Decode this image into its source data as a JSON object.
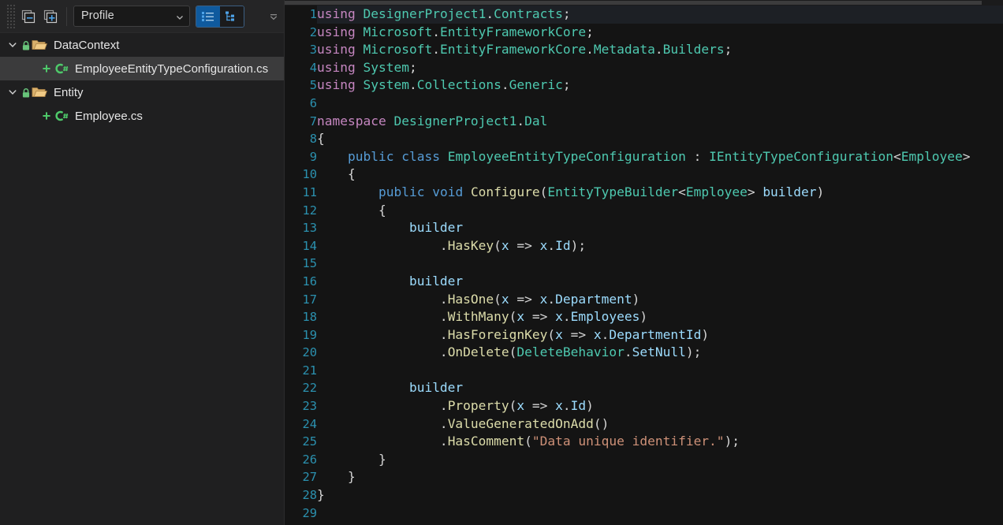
{
  "toolbar": {
    "collapse_all_label": "Collapse All",
    "expand_all_label": "Expand All",
    "profile_value": "Profile",
    "profile_placeholder": "Profile",
    "view_list_label": "List View",
    "view_tree_label": "Tree View",
    "overflow_label": "More",
    "icons": {
      "collapse": "collapse-all-icon",
      "expand": "expand-all-icon",
      "chevron": "chevron-down-icon",
      "list": "list-view-icon",
      "tree": "tree-view-icon",
      "overflow": "overflow-chevron-icon"
    }
  },
  "tree": {
    "nodes": [
      {
        "label": "DataContext",
        "type": "folder",
        "level": 0,
        "expanded": true,
        "locked": true,
        "selected": false
      },
      {
        "label": "EmployeeEntityTypeConfiguration.cs",
        "type": "csharp",
        "level": 1,
        "expanded": false,
        "locked": false,
        "selected": true
      },
      {
        "label": "Entity",
        "type": "folder",
        "level": 0,
        "expanded": true,
        "locked": true,
        "selected": false
      },
      {
        "label": "Employee.cs",
        "type": "csharp",
        "level": 1,
        "expanded": false,
        "locked": false,
        "selected": false
      }
    ]
  },
  "colors": {
    "accent": "#0f5a9e",
    "keyword": "#c586c0",
    "control_keyword": "#569cd6",
    "type": "#4ec9b0",
    "identifier": "#9cdcfe",
    "method": "#dcdcaa",
    "string": "#ce9178",
    "line_number": "#2b91af",
    "selection": "#3b3b3c",
    "editor_bg": "#141414",
    "panel_bg": "#1f1f20",
    "csharp_icon": "#4ec96a",
    "folder_icon": "#dcb67a",
    "lock_icon": "#68c47a"
  },
  "editor": {
    "first_line": 1,
    "last_line": 29,
    "current_line": 1,
    "lines": [
      {
        "n": 1,
        "tokens": [
          {
            "t": "using",
            "c": "k"
          },
          {
            "t": " ",
            "c": "p"
          },
          {
            "t": "DesignerProject1",
            "c": "ty"
          },
          {
            "t": ".",
            "c": "p"
          },
          {
            "t": "Contracts",
            "c": "ty"
          },
          {
            "t": ";",
            "c": "p"
          }
        ]
      },
      {
        "n": 2,
        "tokens": [
          {
            "t": "using",
            "c": "k"
          },
          {
            "t": " ",
            "c": "p"
          },
          {
            "t": "Microsoft",
            "c": "ty"
          },
          {
            "t": ".",
            "c": "p"
          },
          {
            "t": "EntityFrameworkCore",
            "c": "ty"
          },
          {
            "t": ";",
            "c": "p"
          }
        ]
      },
      {
        "n": 3,
        "tokens": [
          {
            "t": "using",
            "c": "k"
          },
          {
            "t": " ",
            "c": "p"
          },
          {
            "t": "Microsoft",
            "c": "ty"
          },
          {
            "t": ".",
            "c": "p"
          },
          {
            "t": "EntityFrameworkCore",
            "c": "ty"
          },
          {
            "t": ".",
            "c": "p"
          },
          {
            "t": "Metadata",
            "c": "ty"
          },
          {
            "t": ".",
            "c": "p"
          },
          {
            "t": "Builders",
            "c": "ty"
          },
          {
            "t": ";",
            "c": "p"
          }
        ]
      },
      {
        "n": 4,
        "tokens": [
          {
            "t": "using",
            "c": "k"
          },
          {
            "t": " ",
            "c": "p"
          },
          {
            "t": "System",
            "c": "ty"
          },
          {
            "t": ";",
            "c": "p"
          }
        ]
      },
      {
        "n": 5,
        "tokens": [
          {
            "t": "using",
            "c": "k"
          },
          {
            "t": " ",
            "c": "p"
          },
          {
            "t": "System",
            "c": "ty"
          },
          {
            "t": ".",
            "c": "p"
          },
          {
            "t": "Collections",
            "c": "ty"
          },
          {
            "t": ".",
            "c": "p"
          },
          {
            "t": "Generic",
            "c": "ty"
          },
          {
            "t": ";",
            "c": "p"
          }
        ]
      },
      {
        "n": 6,
        "tokens": []
      },
      {
        "n": 7,
        "tokens": [
          {
            "t": "namespace",
            "c": "k"
          },
          {
            "t": " ",
            "c": "p"
          },
          {
            "t": "DesignerProject1",
            "c": "ty"
          },
          {
            "t": ".",
            "c": "p"
          },
          {
            "t": "Dal",
            "c": "ty"
          }
        ]
      },
      {
        "n": 8,
        "tokens": [
          {
            "t": "{",
            "c": "p"
          }
        ]
      },
      {
        "n": 9,
        "tokens": [
          {
            "t": "    ",
            "c": "p"
          },
          {
            "t": "public",
            "c": "kb"
          },
          {
            "t": " ",
            "c": "p"
          },
          {
            "t": "class",
            "c": "kb"
          },
          {
            "t": " ",
            "c": "p"
          },
          {
            "t": "EmployeeEntityTypeConfiguration",
            "c": "ty"
          },
          {
            "t": " : ",
            "c": "p"
          },
          {
            "t": "IEntityTypeConfiguration",
            "c": "ty"
          },
          {
            "t": "<",
            "c": "p"
          },
          {
            "t": "Employee",
            "c": "ty"
          },
          {
            "t": ">",
            "c": "p"
          }
        ]
      },
      {
        "n": 10,
        "tokens": [
          {
            "t": "    ",
            "c": "p"
          },
          {
            "t": "{",
            "c": "p"
          }
        ]
      },
      {
        "n": 11,
        "tokens": [
          {
            "t": "        ",
            "c": "p"
          },
          {
            "t": "public",
            "c": "kb"
          },
          {
            "t": " ",
            "c": "p"
          },
          {
            "t": "void",
            "c": "kb"
          },
          {
            "t": " ",
            "c": "p"
          },
          {
            "t": "Configure",
            "c": "fn"
          },
          {
            "t": "(",
            "c": "p"
          },
          {
            "t": "EntityTypeBuilder",
            "c": "ty"
          },
          {
            "t": "<",
            "c": "p"
          },
          {
            "t": "Employee",
            "c": "ty"
          },
          {
            "t": "> ",
            "c": "p"
          },
          {
            "t": "builder",
            "c": "id"
          },
          {
            "t": ")",
            "c": "p"
          }
        ]
      },
      {
        "n": 12,
        "tokens": [
          {
            "t": "        ",
            "c": "p"
          },
          {
            "t": "{",
            "c": "p"
          }
        ]
      },
      {
        "n": 13,
        "tokens": [
          {
            "t": "            ",
            "c": "p"
          },
          {
            "t": "builder",
            "c": "id"
          }
        ]
      },
      {
        "n": 14,
        "tokens": [
          {
            "t": "                .",
            "c": "p"
          },
          {
            "t": "HasKey",
            "c": "fn"
          },
          {
            "t": "(",
            "c": "p"
          },
          {
            "t": "x",
            "c": "id"
          },
          {
            "t": " => ",
            "c": "p"
          },
          {
            "t": "x",
            "c": "id"
          },
          {
            "t": ".",
            "c": "p"
          },
          {
            "t": "Id",
            "c": "id"
          },
          {
            "t": ");",
            "c": "p"
          }
        ]
      },
      {
        "n": 15,
        "tokens": []
      },
      {
        "n": 16,
        "tokens": [
          {
            "t": "            ",
            "c": "p"
          },
          {
            "t": "builder",
            "c": "id"
          }
        ]
      },
      {
        "n": 17,
        "tokens": [
          {
            "t": "                .",
            "c": "p"
          },
          {
            "t": "HasOne",
            "c": "fn"
          },
          {
            "t": "(",
            "c": "p"
          },
          {
            "t": "x",
            "c": "id"
          },
          {
            "t": " => ",
            "c": "p"
          },
          {
            "t": "x",
            "c": "id"
          },
          {
            "t": ".",
            "c": "p"
          },
          {
            "t": "Department",
            "c": "id"
          },
          {
            "t": ")",
            "c": "p"
          }
        ]
      },
      {
        "n": 18,
        "tokens": [
          {
            "t": "                .",
            "c": "p"
          },
          {
            "t": "WithMany",
            "c": "fn"
          },
          {
            "t": "(",
            "c": "p"
          },
          {
            "t": "x",
            "c": "id"
          },
          {
            "t": " => ",
            "c": "p"
          },
          {
            "t": "x",
            "c": "id"
          },
          {
            "t": ".",
            "c": "p"
          },
          {
            "t": "Employees",
            "c": "id"
          },
          {
            "t": ")",
            "c": "p"
          }
        ]
      },
      {
        "n": 19,
        "tokens": [
          {
            "t": "                .",
            "c": "p"
          },
          {
            "t": "HasForeignKey",
            "c": "fn"
          },
          {
            "t": "(",
            "c": "p"
          },
          {
            "t": "x",
            "c": "id"
          },
          {
            "t": " => ",
            "c": "p"
          },
          {
            "t": "x",
            "c": "id"
          },
          {
            "t": ".",
            "c": "p"
          },
          {
            "t": "DepartmentId",
            "c": "id"
          },
          {
            "t": ")",
            "c": "p"
          }
        ]
      },
      {
        "n": 20,
        "tokens": [
          {
            "t": "                .",
            "c": "p"
          },
          {
            "t": "OnDelete",
            "c": "fn"
          },
          {
            "t": "(",
            "c": "p"
          },
          {
            "t": "DeleteBehavior",
            "c": "ty"
          },
          {
            "t": ".",
            "c": "p"
          },
          {
            "t": "SetNull",
            "c": "id"
          },
          {
            "t": ");",
            "c": "p"
          }
        ]
      },
      {
        "n": 21,
        "tokens": []
      },
      {
        "n": 22,
        "tokens": [
          {
            "t": "            ",
            "c": "p"
          },
          {
            "t": "builder",
            "c": "id"
          }
        ]
      },
      {
        "n": 23,
        "tokens": [
          {
            "t": "                .",
            "c": "p"
          },
          {
            "t": "Property",
            "c": "fn"
          },
          {
            "t": "(",
            "c": "p"
          },
          {
            "t": "x",
            "c": "id"
          },
          {
            "t": " => ",
            "c": "p"
          },
          {
            "t": "x",
            "c": "id"
          },
          {
            "t": ".",
            "c": "p"
          },
          {
            "t": "Id",
            "c": "id"
          },
          {
            "t": ")",
            "c": "p"
          }
        ]
      },
      {
        "n": 24,
        "tokens": [
          {
            "t": "                .",
            "c": "p"
          },
          {
            "t": "ValueGeneratedOnAdd",
            "c": "fn"
          },
          {
            "t": "()",
            "c": "p"
          }
        ]
      },
      {
        "n": 25,
        "tokens": [
          {
            "t": "                .",
            "c": "p"
          },
          {
            "t": "HasComment",
            "c": "fn"
          },
          {
            "t": "(",
            "c": "p"
          },
          {
            "t": "\"Data unique identifier.\"",
            "c": "st"
          },
          {
            "t": ");",
            "c": "p"
          }
        ]
      },
      {
        "n": 26,
        "tokens": [
          {
            "t": "        ",
            "c": "p"
          },
          {
            "t": "}",
            "c": "p"
          }
        ]
      },
      {
        "n": 27,
        "tokens": [
          {
            "t": "    ",
            "c": "p"
          },
          {
            "t": "}",
            "c": "p"
          }
        ]
      },
      {
        "n": 28,
        "tokens": [
          {
            "t": "}",
            "c": "p"
          }
        ]
      },
      {
        "n": 29,
        "tokens": []
      }
    ]
  }
}
